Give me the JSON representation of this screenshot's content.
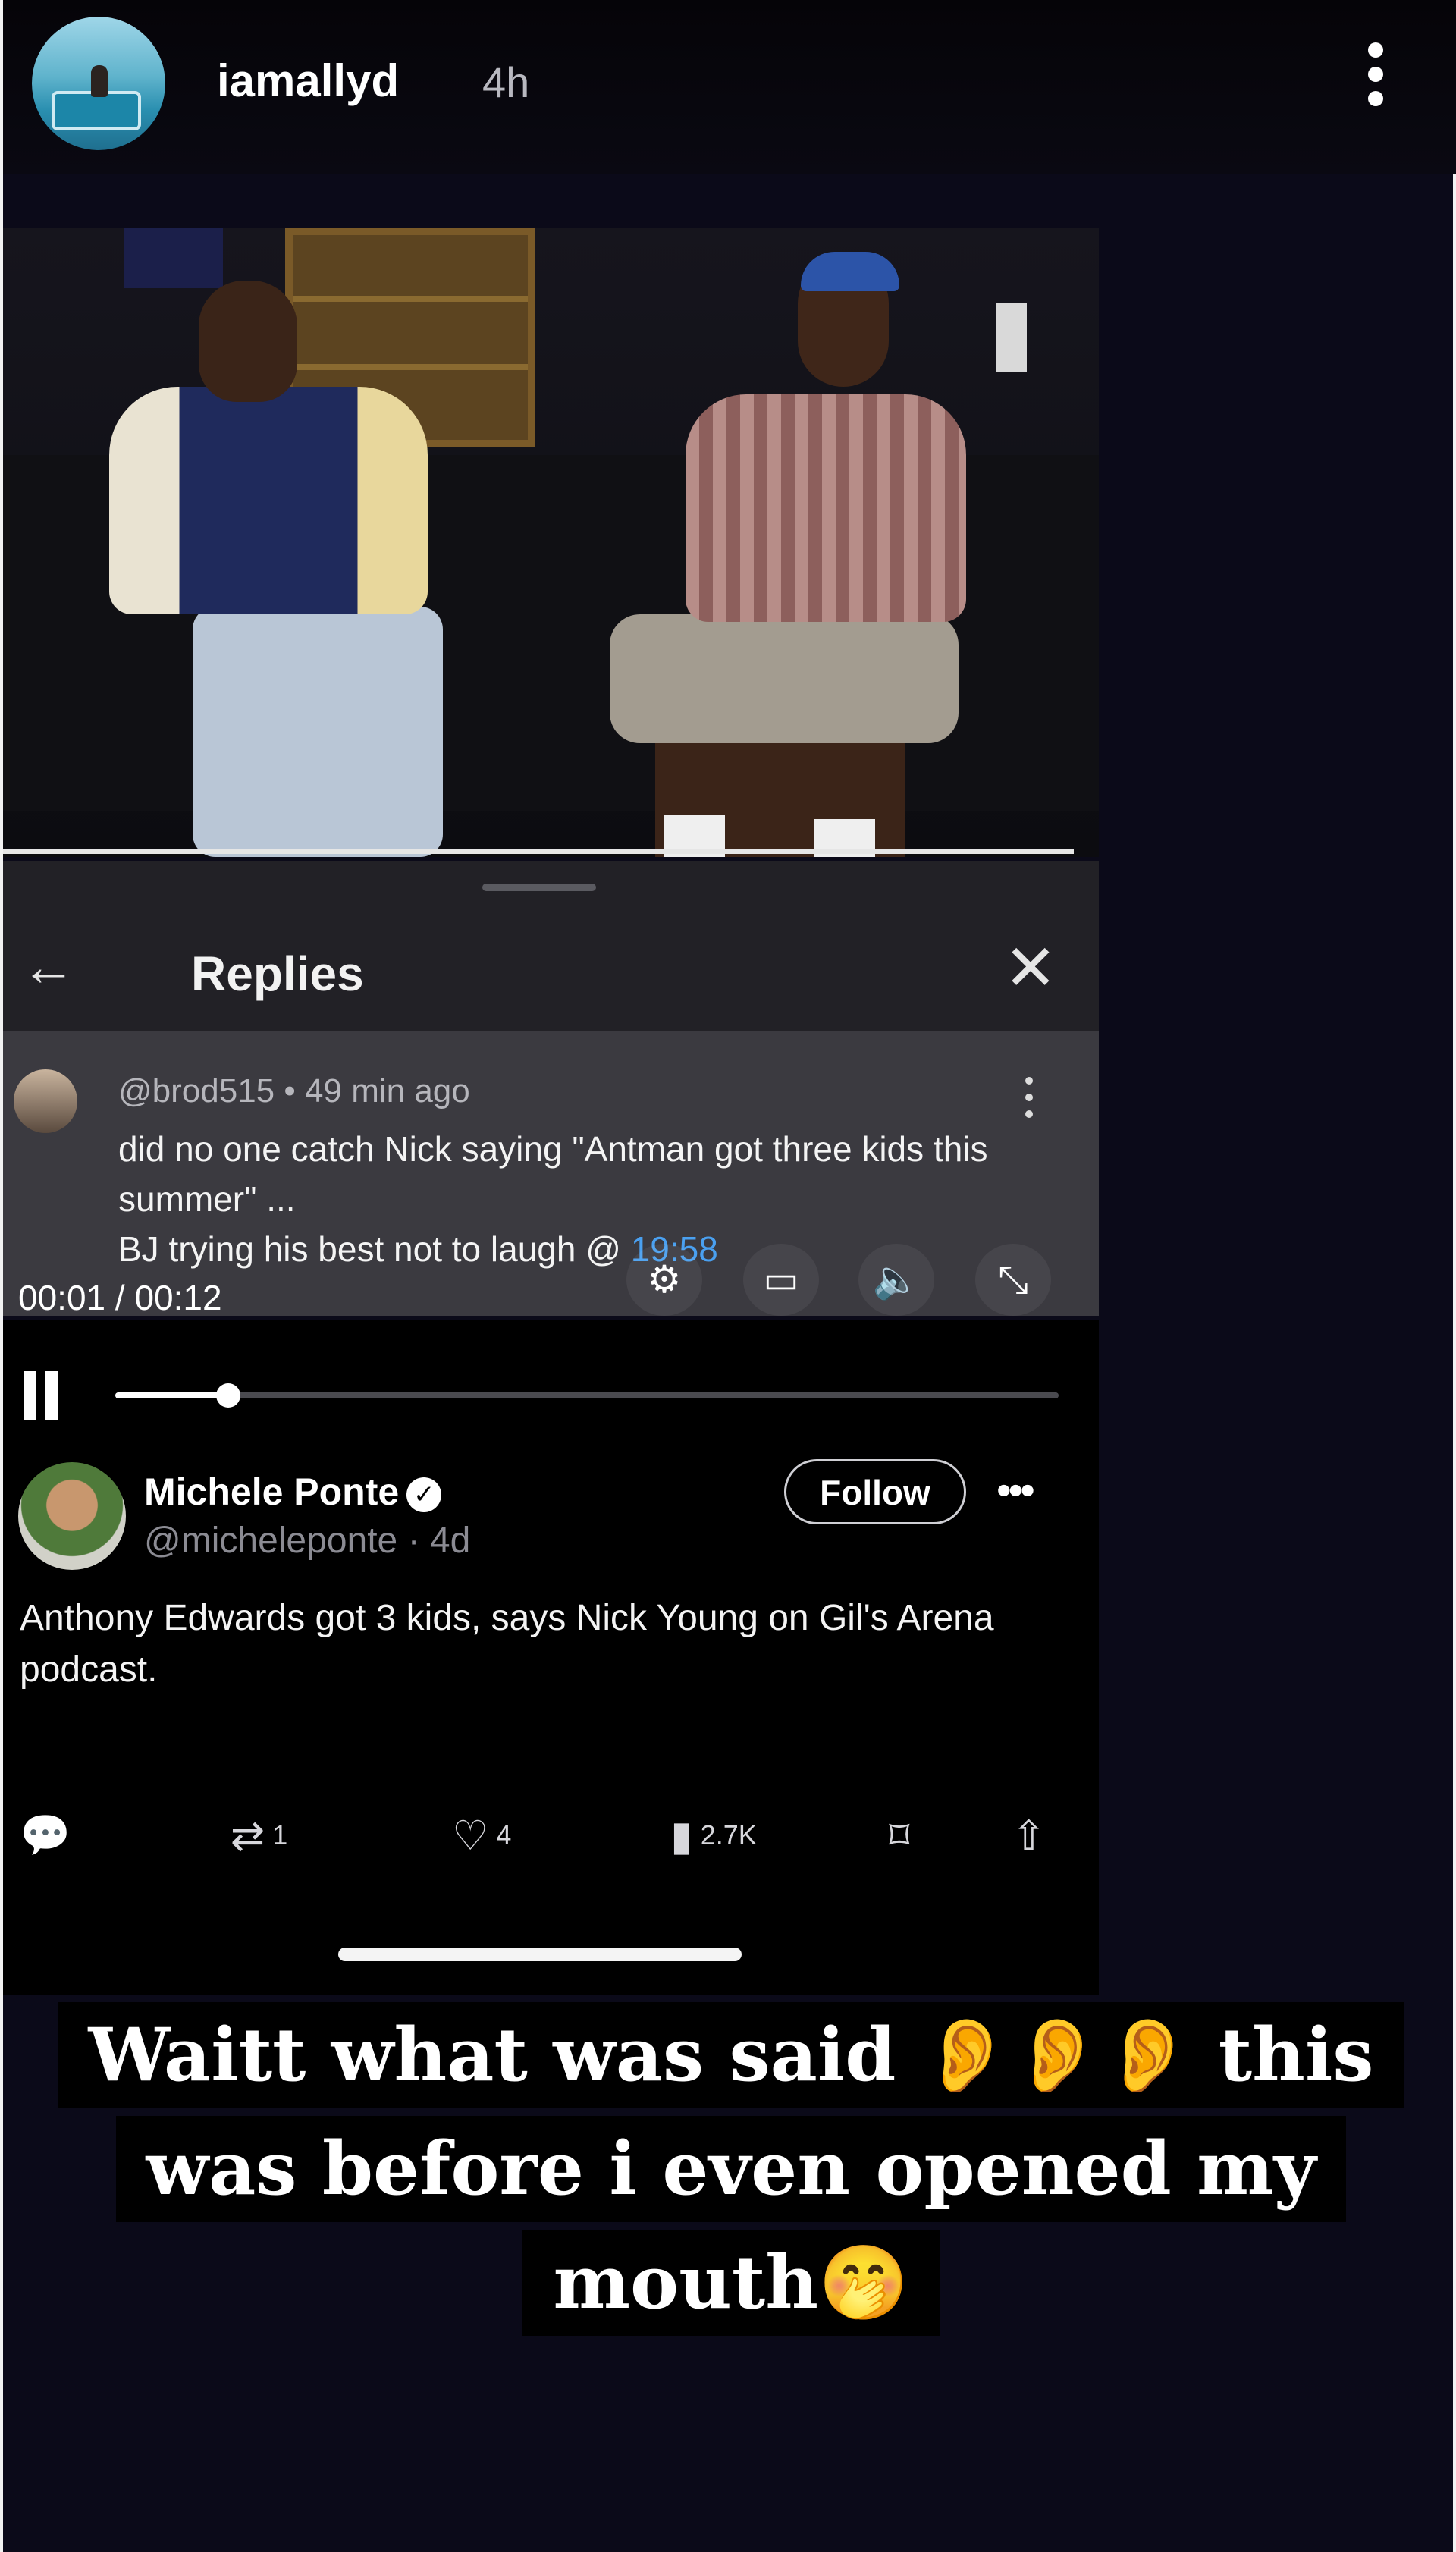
{
  "story": {
    "username": "iamallyd",
    "time_ago": "4h",
    "more_icon": "more-vertical-icon"
  },
  "replies_panel": {
    "title": "Replies",
    "back_icon": "arrow-left-icon",
    "close_icon": "close-icon",
    "reply": {
      "author": "@brod515",
      "time": "49 min ago",
      "text": "did no one catch Nick saying \"Antman got three kids this summer\" ...",
      "text_line3_prefix": "BJ trying his best not to laugh @ ",
      "timestamp_link": "19:58"
    }
  },
  "player": {
    "current_time": "00:01",
    "duration": "00:12",
    "progress_fraction": 0.12,
    "icons": [
      "settings-icon",
      "airplay-icon",
      "volume-icon",
      "minimize-icon"
    ]
  },
  "tweet": {
    "name": "Michele Ponte",
    "handle": "@micheleponte",
    "age": "4d",
    "follow_label": "Follow",
    "text": "Anthony Edwards got 3 kids, says Nick Young on Gil's Arena podcast.",
    "retweets": "1",
    "likes": "4",
    "views": "2.7K"
  },
  "caption": {
    "line1": "Waitt what was said 👂👂👂 this",
    "line2": "was before i even opened my",
    "line3": "mouth🤭"
  }
}
